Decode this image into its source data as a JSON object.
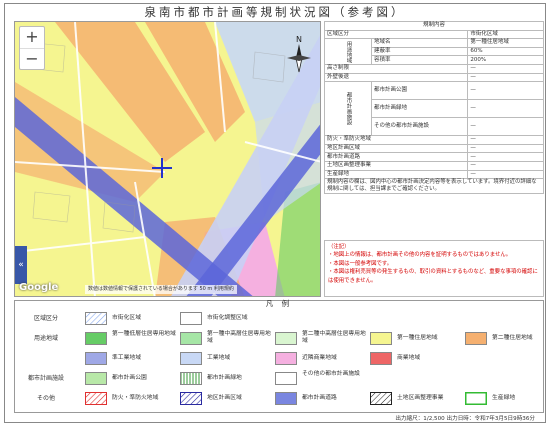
{
  "title": "泉南市都市計画等規制状況図（参考図）",
  "map": {
    "zoom_in": "+",
    "zoom_out": "−",
    "expand": "«",
    "google": "Google",
    "attribution": "数値は数値情報で保護されている場合があります   50 m   利用規約"
  },
  "info": {
    "header": "規制内容",
    "rows": [
      {
        "label": "区域区分",
        "value": "市街化区域"
      },
      {
        "label": "地域名",
        "value": "第一種住居地域"
      },
      {
        "label": "建蔽率",
        "value": "60%"
      },
      {
        "label": "容積率",
        "value": "200%"
      },
      {
        "label": "高さ制限",
        "value": "—"
      },
      {
        "label": "外壁後退",
        "value": "—"
      },
      {
        "label": "都市計画公園",
        "value": "—"
      },
      {
        "label": "都市計画緑地",
        "value": "—"
      },
      {
        "label": "その他の都市計画施設",
        "value": "—"
      },
      {
        "label": "防火・準防火地域",
        "value": "—"
      },
      {
        "label": "地区計画区域",
        "value": "—"
      },
      {
        "label": "都市計画道路",
        "value": "—"
      },
      {
        "label": "土地区画整理事業",
        "value": "—"
      },
      {
        "label": "生産緑地",
        "value": "—"
      }
    ],
    "group1": "用途地域",
    "group2": "都市計画施設",
    "notes": "規制内容の欄は、図内中心の都市計画決定内容等を表示しています。境界付近の詳細な規制に関しては、担当課までご確認ください。"
  },
  "caution": {
    "title": "（注記）",
    "lines": [
      "・地図上の情報は、都市計画その他の内容を証明するものではありません。",
      "・本図は一般参考図です。",
      "・本図は権利売買等の発生するもの、取引の資料とするものなど、重要な事項の確認には使用できません。"
    ]
  },
  "legend": {
    "title": "凡 例",
    "rows": [
      {
        "label": "区域区分",
        "items": [
          {
            "name": "市街化区域",
            "swatch": "hatch-blue"
          },
          {
            "name": "市街化調整区域",
            "swatch": "white"
          }
        ]
      },
      {
        "label": "用途地域",
        "items": [
          {
            "name": "第一種低層住居専用地域",
            "swatch": "#66cc66"
          },
          {
            "name": "第一種中高層住居専用地域",
            "swatch": "#a6e6a6"
          },
          {
            "name": "第二種中高層住居専用地域",
            "swatch": "#d9f5d0"
          },
          {
            "name": "第一種住居地域",
            "swatch": "#f5f590"
          },
          {
            "name": "第二種住居地域",
            "swatch": "#f5b070"
          }
        ]
      },
      {
        "label": "",
        "items": [
          {
            "name": "準工業地域",
            "swatch": "#9fa8e6"
          },
          {
            "name": "工業地域",
            "swatch": "#c8d8f5"
          },
          {
            "name": "近隣商業地域",
            "swatch": "#f5b0e0"
          },
          {
            "name": "商業地域",
            "swatch": "#ee6666"
          }
        ]
      },
      {
        "label": "都市計画施設",
        "items": [
          {
            "name": "都市計画公園",
            "swatch": "#b8e8a8"
          },
          {
            "name": "都市計画緑地",
            "swatch": "stripe-green"
          },
          {
            "name": "その他の都市計画施設",
            "swatch": "white"
          }
        ]
      },
      {
        "label": "その他",
        "items": [
          {
            "name": "防火・準防火地域",
            "swatch": "hatch-red"
          },
          {
            "name": "地区計画区域",
            "swatch": "hatch-darkblue"
          },
          {
            "name": "都市計画道路",
            "swatch": "#7a86e0"
          },
          {
            "name": "土地区画整理事業",
            "swatch": "hatch-black"
          },
          {
            "name": "生産緑地",
            "swatch": "green-border"
          }
        ]
      }
    ]
  },
  "footer": "出力縮尺：1/2,500  出力日時：令和7年3月5日9時36分"
}
